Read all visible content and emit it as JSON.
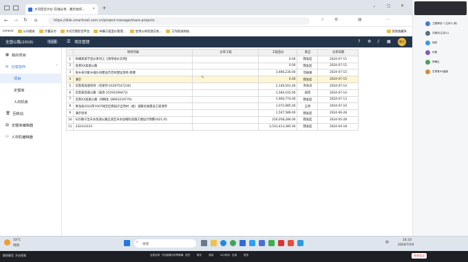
{
  "browser": {
    "tab_title": "大司空云计价-在线分享、教示协作...",
    "url": "https://disk.smartcost.com.cn/project-manage/share-projects",
    "bookmarks": [
      "Lenovo",
      "公司相关",
      "计量支付",
      "大司空管控云平台",
      "纵横工程造价管理...",
      "甘肃公共资源交易...",
      "工作相关网站"
    ],
    "other_bookmarks": "其他收藏夹"
  },
  "app": {
    "title": "全国公路(2018)",
    "badge": "专业版",
    "page_title": "项目管理",
    "avatar": "晓玉"
  },
  "sidebar": {
    "items": [
      {
        "label": "我的项目"
      },
      {
        "label": "分享协作"
      },
      {
        "label": "项目"
      },
      {
        "label": "定额库"
      },
      {
        "label": "人材机库"
      },
      {
        "label": "回收站"
      },
      {
        "label": "定额库编辑器"
      },
      {
        "label": "人材机编辑器"
      }
    ]
  },
  "table": {
    "headers": [
      "",
      "项目列表",
      "分享工程",
      "工程造价",
      "来自",
      "分享日期"
    ],
    "rows": [
      [
        "1",
        "纵横某某学造价系列之【清单组价实例】",
        "",
        "0.00",
        "我发起",
        "2024-07-15"
      ],
      [
        "2",
        "甘肃XX高速公路",
        "",
        "0.00",
        "我发起",
        "2024-07-15"
      ],
      [
        "3",
        "张乡县刘家乡福头村建设示范村建设项目-新模",
        "",
        "3,466,230.00",
        "何丽娟",
        "2024-07-15"
      ],
      [
        "4",
        "演示",
        "",
        "0.00",
        "我发起",
        "2024-07-15"
      ],
      [
        "5",
        "云南某高速项目（刘某伟-16397547230)",
        "",
        "2,149,501.00",
        "洪海洋",
        "2024-07-14"
      ],
      [
        "6",
        "云南某高速公路（阎亮-15293199472)",
        "",
        "1,584,102.00",
        "阎亮",
        "2024-07-14"
      ],
      [
        "7",
        "云南XX高速公路（郑梅生 18993219770)",
        "",
        "1,900,774.00",
        "我发起",
        "2024-07-13"
      ],
      [
        "8",
        "青海县2024年Y007线至红柳园子自然村（组）道路优质建设工程清单",
        "",
        "1,072,985.00",
        "王昕",
        "2024-07-10"
      ],
      [
        "9",
        "演示项目",
        "",
        "1,507,589.00",
        "我发起",
        "2024-06-28"
      ],
      [
        "10",
        "S25静宁至天水高速公路庄浪至天水段两阶段施工图设计预算2021.05",
        "",
        "250,058,286.00",
        "我发起",
        "2024-05-28"
      ],
      [
        "11",
        "333333333",
        "",
        "2,531,413,385.00",
        "我发起",
        "2024-04-18"
      ]
    ],
    "highlight_row": 3
  },
  "taskbar": {
    "weather_temp": "33°C",
    "weather_desc": "晴朗",
    "search_placeholder": "搜索",
    "time": "14:33",
    "date": "2024/7/19",
    "lang": "中"
  },
  "meeting": {
    "buttons": [
      "全麦克风",
      "开启摄像头",
      "共享屏幕",
      "成员",
      "聊天",
      "录制",
      "AI小助手",
      "应用",
      "更多"
    ],
    "end_label": "结束会议",
    "left1": "解除静音",
    "left2": "开启视频"
  },
  "participants": [
    {
      "name": "卫星驿站一(主持人,我)"
    },
    {
      "name": "刘某伟(主持人)"
    },
    {
      "name": "阎亮"
    },
    {
      "name": "何丽"
    },
    {
      "name": "郑梅生"
    },
    {
      "name": "甘肃某XX高速"
    }
  ]
}
